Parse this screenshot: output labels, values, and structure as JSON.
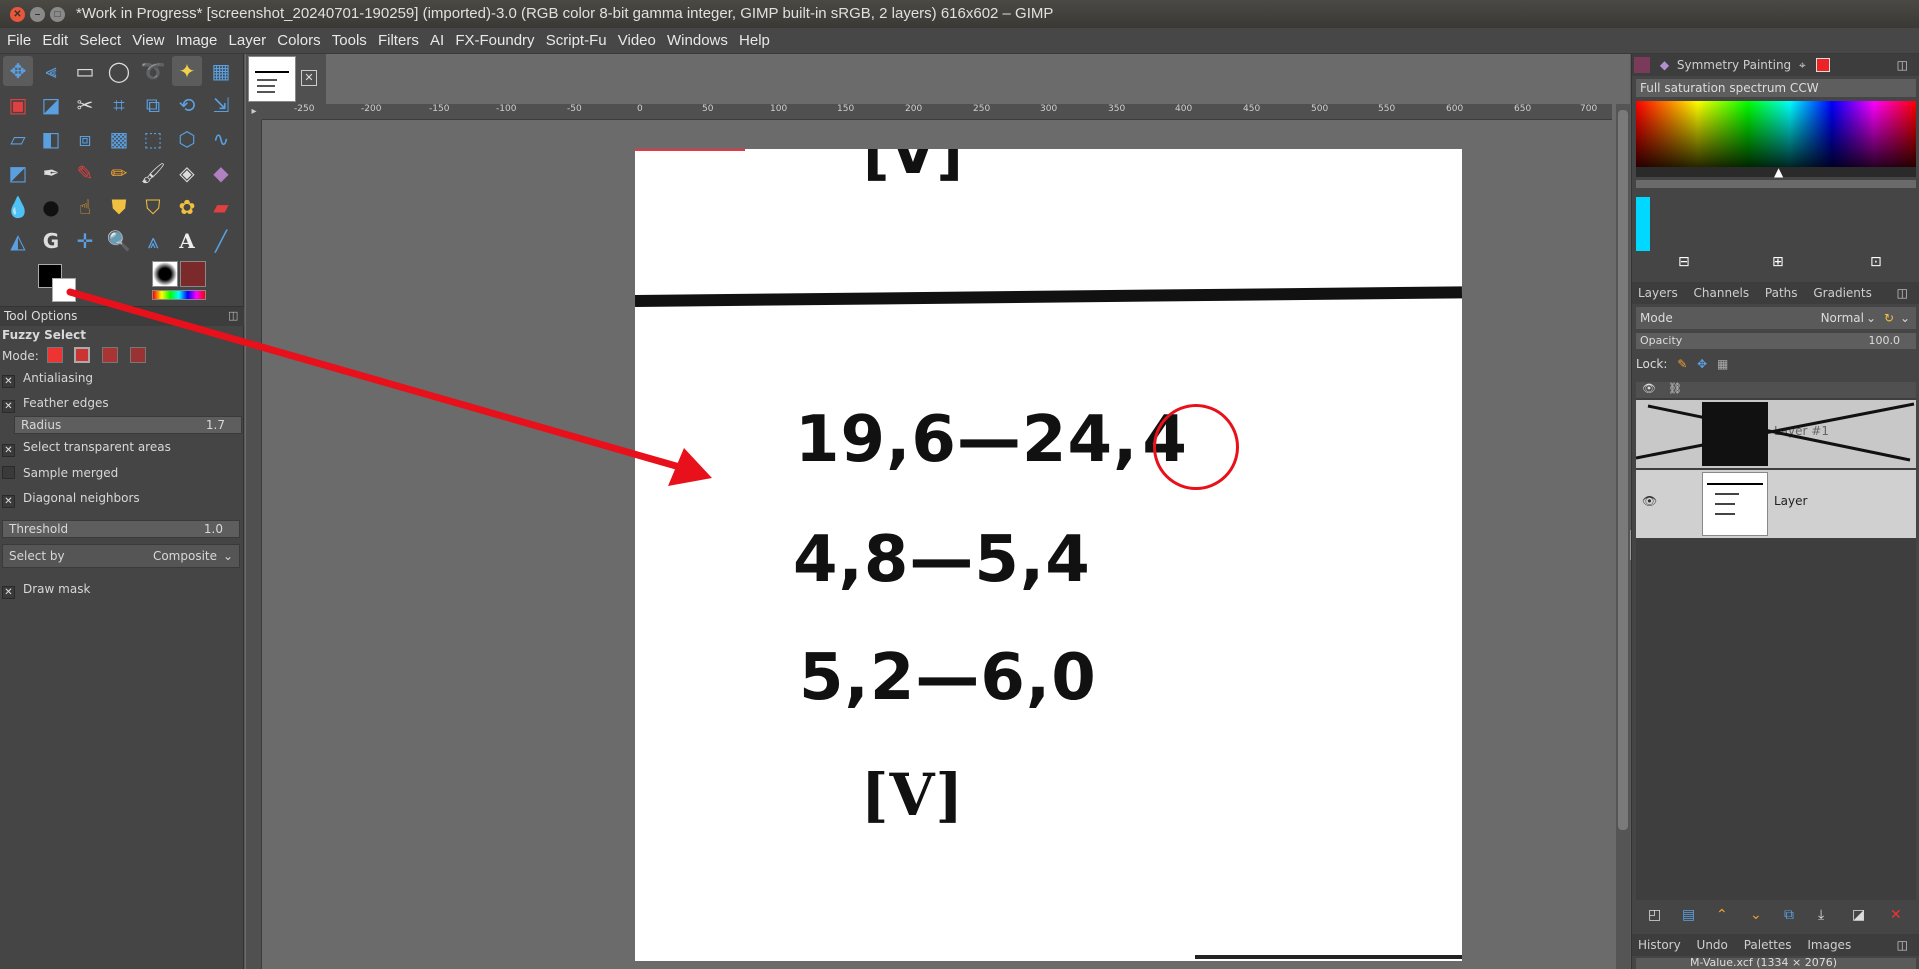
{
  "window": {
    "title": "*Work in Progress* [screenshot_20240701-190259] (imported)-3.0 (RGB color 8-bit gamma integer, GIMP built-in sRGB, 2 layers) 616x602 – GIMP"
  },
  "menu": [
    "File",
    "Edit",
    "Select",
    "View",
    "Image",
    "Layer",
    "Colors",
    "Tools",
    "Filters",
    "AI",
    "FX-Foundry",
    "Script-Fu",
    "Video",
    "Windows",
    "Help"
  ],
  "tool_options": {
    "tab_label": "Tool Options",
    "tool_name": "Fuzzy Select",
    "mode_label": "Mode:",
    "antialiasing": "Antialiasing",
    "feather_edges": "Feather edges",
    "radius_label": "Radius",
    "radius_value": "1.7",
    "select_transparent": "Select transparent areas",
    "sample_merged": "Sample merged",
    "diagonal_neighbors": "Diagonal neighbors",
    "threshold_label": "Threshold",
    "threshold_value": "1.0",
    "select_by_label": "Select by",
    "select_by_value": "Composite",
    "draw_mask": "Draw mask"
  },
  "ruler_ticks": [
    "-250",
    "-200",
    "-150",
    "-100",
    "-50",
    "0",
    "50",
    "100",
    "150",
    "200",
    "250",
    "300",
    "350",
    "400",
    "450",
    "500",
    "550",
    "600",
    "650",
    "700"
  ],
  "document": {
    "top_glyph": "[V]",
    "line1": "19,6—24,",
    "line1_circled": "4",
    "line2": "4,8—5,4",
    "line3": "5,2—6,0",
    "bottom_glyph": "[V]"
  },
  "colors_panel": {
    "tab_label": "Symmetry Painting",
    "gradient_name": "Full saturation spectrum CCW"
  },
  "layers_panel": {
    "tabs": [
      "Layers",
      "Channels",
      "Paths",
      "Gradients"
    ],
    "mode_label": "Mode",
    "mode_value": "Normal",
    "opacity_label": "Opacity",
    "opacity_value": "100.0",
    "lock_label": "Lock:",
    "layers": [
      {
        "name": "Layer #1",
        "hidden": true
      },
      {
        "name": "Layer",
        "hidden": false
      }
    ]
  },
  "history_panel": {
    "tabs": [
      "History",
      "Undo",
      "Palettes",
      "Images"
    ],
    "entry": "M-Value.xcf (1334 × 2076)"
  },
  "colors": {
    "annotation_red": "#e8101a",
    "cyan_swatch": "#00d8ff"
  }
}
